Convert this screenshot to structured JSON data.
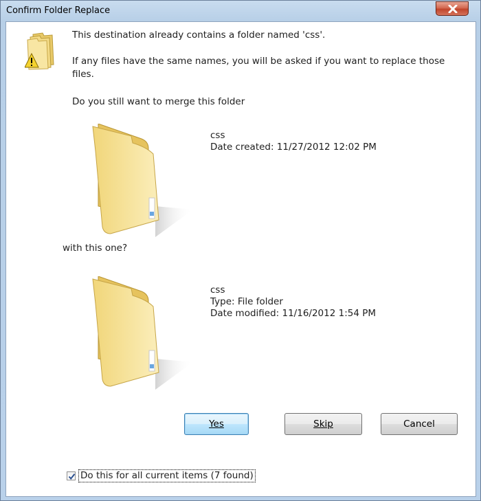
{
  "window": {
    "title": "Confirm Folder Replace"
  },
  "message": {
    "line1": "This destination already contains a folder named 'css'.",
    "line2": "If any files have the same names, you will be asked if you want to replace those files.",
    "line3": "Do you still want to merge this folder",
    "line4": "with this one?"
  },
  "existing_folder": {
    "name": "css",
    "date_created": "Date created: 11/27/2012 12:02 PM"
  },
  "new_folder": {
    "name": "css",
    "type": "Type: File folder",
    "date_modified": "Date modified: 11/16/2012 1:54 PM"
  },
  "buttons": {
    "yes_label": "Yes",
    "skip_label": "Skip",
    "cancel_label": "Cancel"
  },
  "apply_all": {
    "checked": true,
    "label": "Do this for all current items (7 found)"
  },
  "icons": [
    "close-icon",
    "warning-folder-icon",
    "folder-icon",
    "checkmark-icon"
  ],
  "colors": {
    "accent_button": "#bee6fd",
    "close_button": "#c0452c",
    "frame": "#b9d1ea"
  }
}
